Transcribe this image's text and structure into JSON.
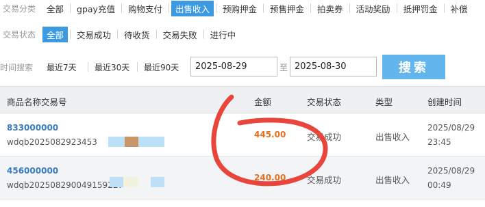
{
  "type_filter": {
    "label": "交易分类",
    "options": [
      "全部",
      "gpay充值",
      "购物支付",
      "出售收入",
      "预购押金",
      "预售押金",
      "拍卖券",
      "活动奖励",
      "抵押罚金",
      "补偿"
    ],
    "active": "出售收入"
  },
  "status_filter": {
    "label": "交易状态",
    "options": [
      "全部",
      "交易成功",
      "待收货",
      "交易失败",
      "进行中"
    ],
    "active": "全部"
  },
  "search": {
    "label": "时间搜索",
    "quick_ranges": [
      "最近7天",
      "最近30天",
      "最近90天"
    ],
    "date_from": "2025-08-29",
    "to_label": "至",
    "date_to": "2025-08-30",
    "button": "搜索"
  },
  "table": {
    "columns": [
      "商品名称交易号",
      "金额",
      "交易状态",
      "类型",
      "创建时间"
    ],
    "rows": [
      {
        "product_id": "833000000",
        "trade_no": "wdqb2025082923453",
        "amount": "445.00",
        "status": "交易成功",
        "type": "出售收入",
        "date": "2025/08/29",
        "time": "23:45"
      },
      {
        "product_id": "456000000",
        "trade_no": "wdqb202508290049159227",
        "amount": "240.00",
        "status": "交易成功",
        "type": "出售收入",
        "date": "2025/08/29",
        "time": "00:49"
      }
    ]
  },
  "colors": {
    "accent": "#3d9ae0",
    "search_button": "#62b5ed",
    "amount": "#e4701e",
    "product_link": "#3a7cc0",
    "annotation": "#e8453c"
  }
}
